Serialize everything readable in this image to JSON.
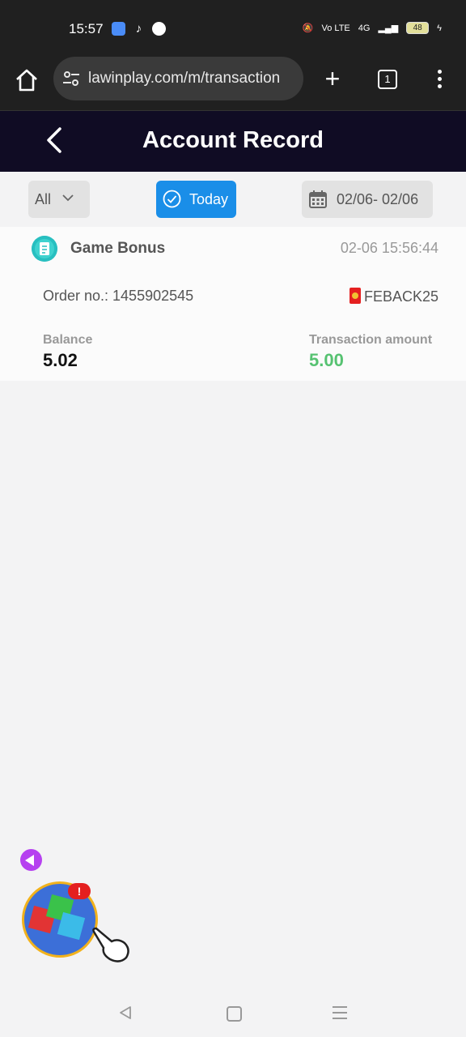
{
  "status_bar": {
    "time": "15:57",
    "app_icons": [
      "files-icon",
      "tiktok-icon",
      "messenger-icon"
    ],
    "signal_text": "Vo LTE",
    "network": "4G",
    "battery": "48"
  },
  "browser": {
    "url": "lawinplay.com/m/transaction",
    "tab_count": "1"
  },
  "header": {
    "title": "Account Record"
  },
  "filters": {
    "type_selected": "All",
    "today_label": "Today",
    "date_range": "02/06- 02/06"
  },
  "record": {
    "title": "Game Bonus",
    "time": "02-06 15:56:44",
    "order_label": "Order no.: 1455902545",
    "bonus_code": "FEBACK25",
    "balance_label": "Balance",
    "balance_value": "5.02",
    "amount_label": "Transaction amount",
    "amount_value": "5.00"
  },
  "widget": {
    "badge": "!"
  },
  "colors": {
    "header_bg": "#100c24",
    "today_blue": "#1a8ee8",
    "amount_green": "#56c271"
  }
}
